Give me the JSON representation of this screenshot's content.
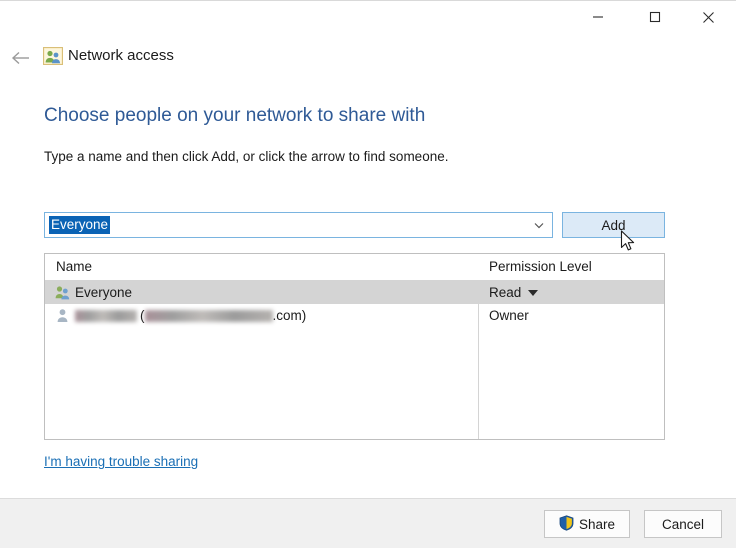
{
  "window": {
    "title": "Network access",
    "icon": "network-share-people-icon",
    "controls": {
      "minimize": "minimize-icon",
      "maximize": "maximize-icon",
      "close": "close-icon"
    },
    "back": "back-arrow-icon"
  },
  "content": {
    "heading": "Choose people on your network to share with",
    "instruction": "Type a name and then click Add, or click the arrow to find someone.",
    "trouble_link": "I'm having trouble sharing"
  },
  "name_entry": {
    "value": "Everyone",
    "placeholder": "",
    "selected": true,
    "dropdown_icon": "chevron-down-icon",
    "add_label": "Add"
  },
  "share_list": {
    "columns": [
      "Name",
      "Permission Level"
    ],
    "rows": [
      {
        "name": "Everyone",
        "icon": "group-users-icon",
        "permission": "Read",
        "has_dropdown": true,
        "selected": true,
        "redacted": false
      },
      {
        "name": ".com)",
        "icon": "single-user-icon",
        "permission": "Owner",
        "has_dropdown": false,
        "selected": false,
        "redacted": true
      }
    ]
  },
  "footer": {
    "share_label": "Share",
    "share_icon": "uac-shield-icon",
    "cancel_label": "Cancel"
  },
  "colors": {
    "heading": "#2f5a96",
    "link": "#1a6fb5",
    "selection": "#0a63b5",
    "hover_button": "#dceaf7",
    "row_selected": "#d4d4d4",
    "footer_bg": "#f0f0f0"
  },
  "cursor": {
    "icon": "mouse-pointer-icon",
    "over": "Add"
  }
}
